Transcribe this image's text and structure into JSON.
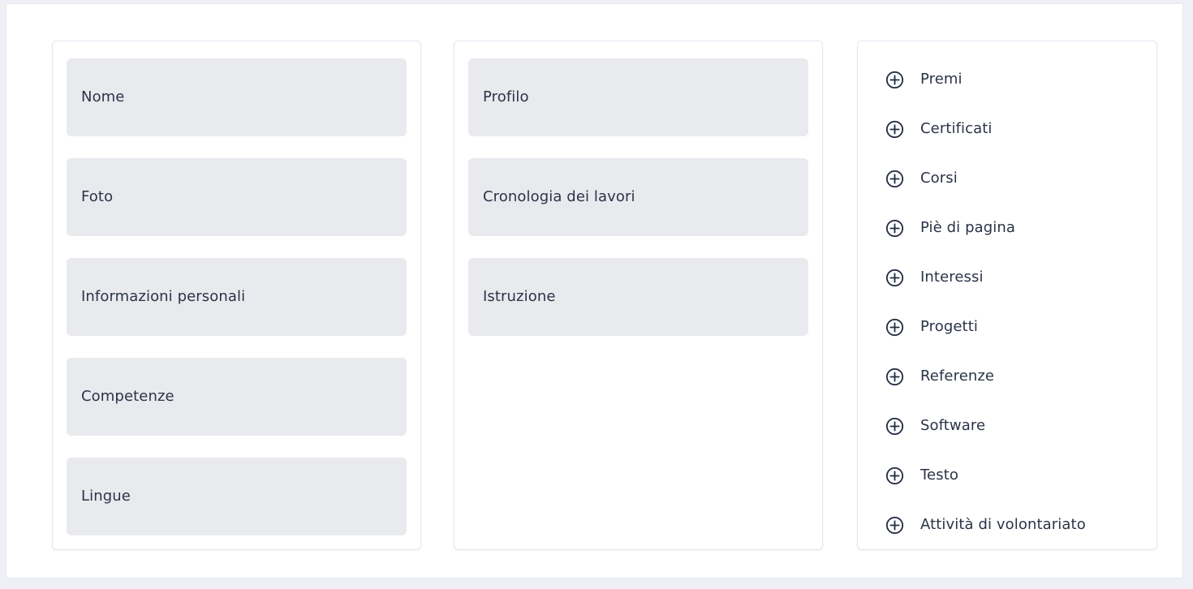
{
  "theme": {
    "page_background": "#eef0f5",
    "panel_background": "#ffffff",
    "card_border": "#e4e6ef",
    "block_background": "#e9eaee",
    "text_color": "#2b3347",
    "icon_color": "#232c43"
  },
  "columns": {
    "left": {
      "name": "resume-sections-column-1",
      "blocks": [
        {
          "label": "Nome"
        },
        {
          "label": "Foto"
        },
        {
          "label": "Informazioni personali"
        },
        {
          "label": "Competenze"
        },
        {
          "label": "Lingue"
        }
      ]
    },
    "middle": {
      "name": "resume-sections-column-2",
      "blocks": [
        {
          "label": "Profilo"
        },
        {
          "label": "Cronologia dei lavori"
        },
        {
          "label": "Istruzione"
        }
      ]
    },
    "right": {
      "name": "add-section-column",
      "icon": "plus-circle-icon",
      "items": [
        {
          "label": "Premi"
        },
        {
          "label": "Certificati"
        },
        {
          "label": "Corsi"
        },
        {
          "label": "Piè di pagina"
        },
        {
          "label": "Interessi"
        },
        {
          "label": "Progetti"
        },
        {
          "label": "Referenze"
        },
        {
          "label": "Software"
        },
        {
          "label": "Testo"
        },
        {
          "label": "Attività di volontariato"
        }
      ]
    }
  }
}
